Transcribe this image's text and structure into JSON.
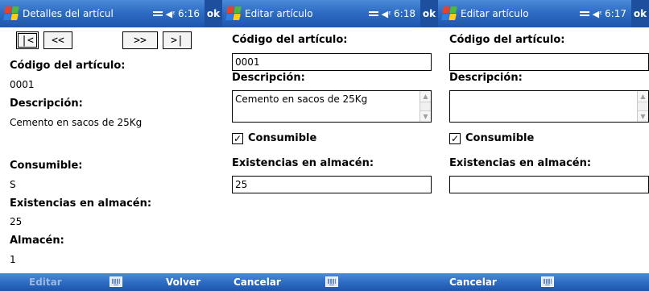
{
  "screens": [
    {
      "title": "Detalles del artícul",
      "time": "6:16",
      "ok": "ok",
      "nav": {
        "first": "|<",
        "prev": "<<",
        "next": ">>",
        "last": ">|"
      },
      "code_label": "Código del artículo:",
      "code_value": "0001",
      "desc_label": "Descripción:",
      "desc_value": "Cemento en sacos de 25Kg",
      "consumible_label": "Consumible:",
      "consumible_value": "S",
      "stock_label": "Existencias en almacén:",
      "stock_value": "25",
      "warehouse_label": "Almacén:",
      "warehouse_value": "1",
      "left_softkey": "Editar",
      "right_softkey": "Volver"
    },
    {
      "title": "Editar artículo",
      "time": "6:18",
      "ok": "ok",
      "code_label": "Código del artículo:",
      "code_value": "0001",
      "desc_label": "Descripción:",
      "desc_value": "Cemento en sacos de 25Kg",
      "consumible_label": "Consumible",
      "consumible_checked": true,
      "stock_label": "Existencias en almacén:",
      "stock_value": "25",
      "left_softkey": "Cancelar"
    },
    {
      "title": "Editar artículo",
      "time": "6:17",
      "ok": "ok",
      "code_label": "Código del artículo:",
      "code_value": "",
      "desc_label": "Descripción:",
      "desc_value": "",
      "consumible_label": "Consumible",
      "consumible_checked": true,
      "stock_label": "Existencias en almacén:",
      "stock_value": "",
      "left_softkey": "Cancelar"
    }
  ],
  "icons": {
    "start": "windows-flag-icon",
    "connectivity": "sync-icon",
    "volume": "volume-icon",
    "keyboard": "keyboard-icon",
    "check": "✓"
  },
  "colors": {
    "titlebar": "#2e6dc4",
    "ok_button": "#1d4f9f",
    "disabled_softkey": "#9bb8e0"
  }
}
